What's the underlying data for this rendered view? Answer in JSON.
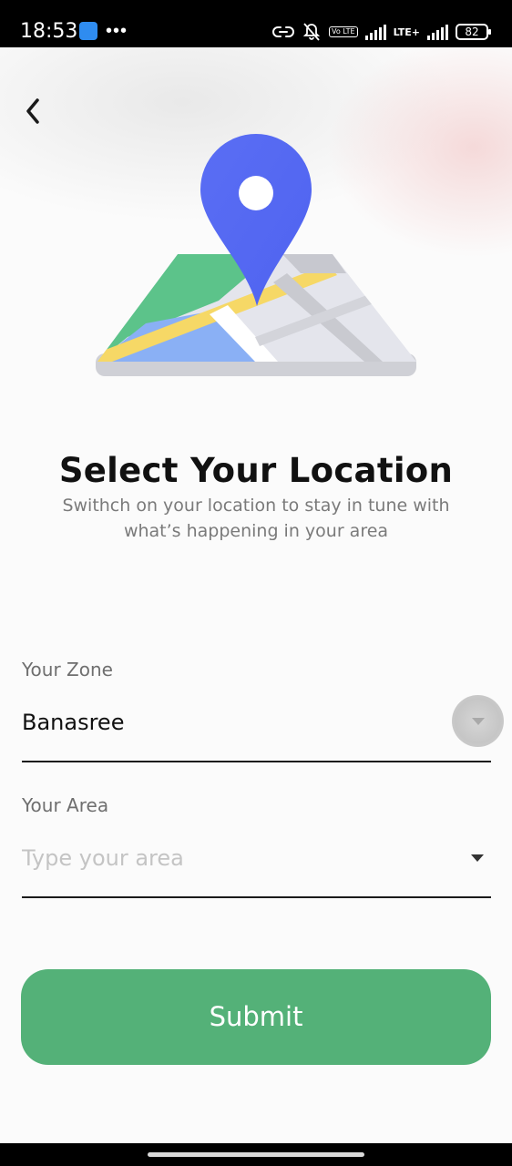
{
  "status_bar": {
    "time": "18:53",
    "more_dots": "•••",
    "volte": "Vo LTE",
    "lte": "LTE+",
    "battery": "82"
  },
  "header": {
    "back_icon": "chevron-left-icon"
  },
  "hero": {
    "title": "Select Your Location",
    "subtitle": "Swithch on your location to stay in tune with what’s happening in your area"
  },
  "form": {
    "zone": {
      "label": "Your Zone",
      "value": "Banasree",
      "icon": "caret-down-icon"
    },
    "area": {
      "label": "Your Area",
      "value": "",
      "placeholder": "Type your area",
      "icon": "caret-down-icon"
    },
    "submit_label": "Submit"
  },
  "colors": {
    "accent": "#54b178",
    "pin": "#5b6ef5",
    "map_green": "#5cc38a",
    "map_yellow": "#f6d866",
    "map_blue": "#8ab0f5",
    "map_gray": "#d2d3d8"
  }
}
